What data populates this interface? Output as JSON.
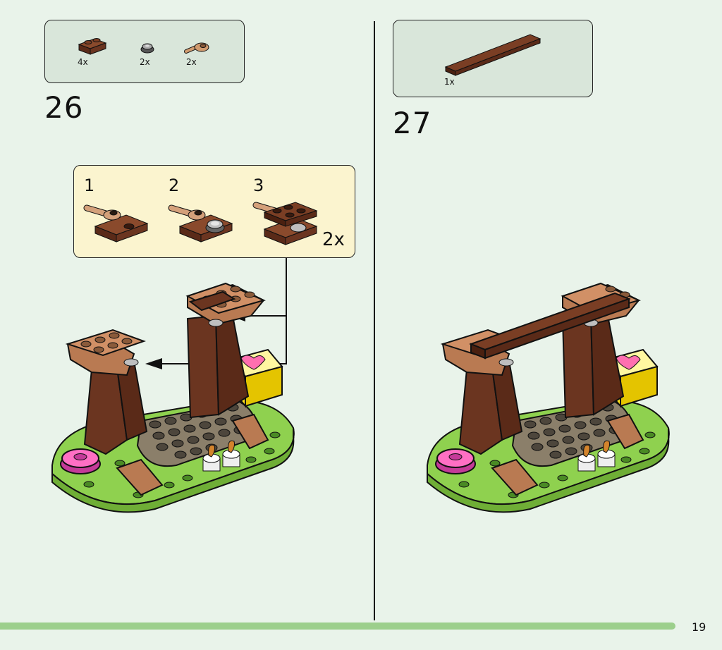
{
  "step26": {
    "number": "26",
    "parts": [
      {
        "qty": "4x",
        "icon": "brown-plate-1x2"
      },
      {
        "qty": "2x",
        "icon": "grey-round-tile"
      },
      {
        "qty": "2x",
        "icon": "tan-bar-clip"
      }
    ],
    "substeps": [
      {
        "number": "1"
      },
      {
        "number": "2"
      },
      {
        "number": "3"
      }
    ],
    "substep_multiplier": "2x"
  },
  "step27": {
    "number": "27",
    "parts": [
      {
        "qty": "1x",
        "icon": "brown-long-plate"
      }
    ]
  },
  "page_number": "19",
  "colors": {
    "background": "#e9f3ea",
    "parts_box": "#d9e6da",
    "substep_box": "#fbf4cf",
    "footer_bar": "#9ccf8c",
    "brown": "#6b3520",
    "tan": "#b97a52",
    "green": "#8fd14f",
    "pink": "#ff6fc4",
    "yellow": "#ffe21a"
  }
}
